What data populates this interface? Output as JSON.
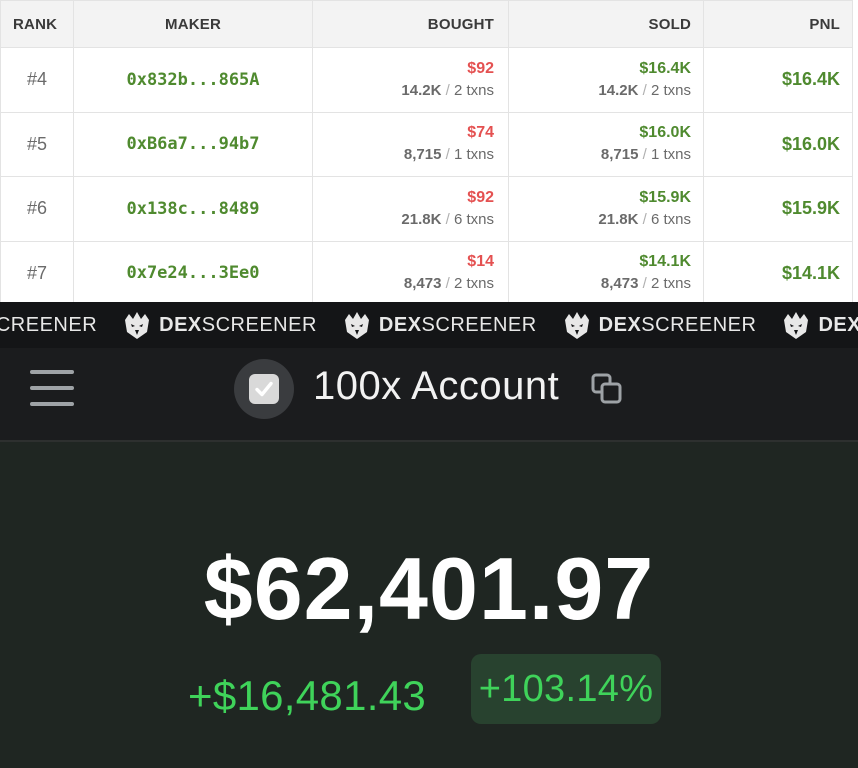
{
  "table": {
    "headers": {
      "rank": "RANK",
      "maker": "MAKER",
      "bought": "BOUGHT",
      "sold": "SOLD",
      "pnl": "PNL"
    },
    "rows": [
      {
        "rank": "#4",
        "maker": "0x832b...865A",
        "bought_usd": "$92",
        "bought_qty": "14.2K",
        "bought_txns": "2 txns",
        "sold_usd": "$16.4K",
        "sold_qty": "14.2K",
        "sold_txns": "2 txns",
        "pnl": "$16.4K"
      },
      {
        "rank": "#5",
        "maker": "0xB6a7...94b7",
        "bought_usd": "$74",
        "bought_qty": "8,715",
        "bought_txns": "1 txns",
        "sold_usd": "$16.0K",
        "sold_qty": "8,715",
        "sold_txns": "1 txns",
        "pnl": "$16.0K"
      },
      {
        "rank": "#6",
        "maker": "0x138c...8489",
        "bought_usd": "$92",
        "bought_qty": "21.8K",
        "bought_txns": "6 txns",
        "sold_usd": "$15.9K",
        "sold_qty": "21.8K",
        "sold_txns": "6 txns",
        "pnl": "$15.9K"
      },
      {
        "rank": "#7",
        "maker": "0x7e24...3Ee0",
        "bought_usd": "$14",
        "bought_qty": "8,473",
        "bought_txns": "2 txns",
        "sold_usd": "$14.1K",
        "sold_qty": "8,473",
        "sold_txns": "2 txns",
        "pnl": "$14.1K"
      }
    ]
  },
  "watermark": {
    "dex": "DEX",
    "screener": "SCREENER",
    "icon": "eagle-logo-icon"
  },
  "account": {
    "title": "100x Account",
    "menu_icon": "hamburger-menu-icon",
    "avatar_icon": "checkbox-icon",
    "copy_icon": "copy-icon",
    "balance": "$62,401.97",
    "change": "+$16,481.43",
    "change_pct": "+103.14%"
  },
  "colors": {
    "positive": "#4f8a2f",
    "negative": "#e45151",
    "gain_bright": "#3fd35a",
    "panel_bg": "#1f2622"
  }
}
